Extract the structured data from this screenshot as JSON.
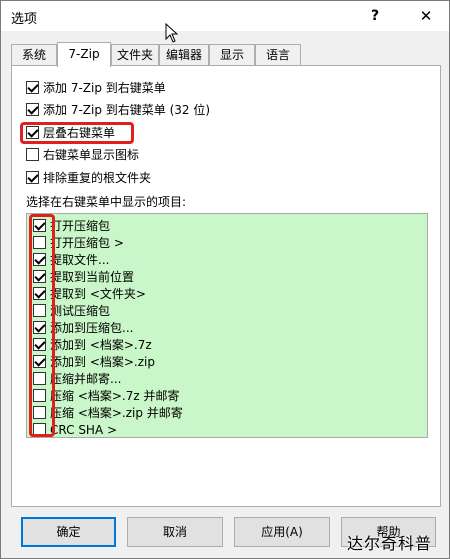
{
  "window": {
    "title": "选项",
    "help_label": "?",
    "close_label": "✕"
  },
  "tabs": [
    {
      "label": "系统",
      "active": false
    },
    {
      "label": "7-Zip",
      "active": true
    },
    {
      "label": "文件夹",
      "active": false
    },
    {
      "label": "编辑器",
      "active": false
    },
    {
      "label": "显示",
      "active": false
    },
    {
      "label": "语言",
      "active": false
    }
  ],
  "options": [
    {
      "label": "添加 7-Zip 到右键菜单",
      "checked": true
    },
    {
      "label": "添加 7-Zip 到右键菜单 (32 位)",
      "checked": true
    },
    {
      "label": "层叠右键菜单",
      "checked": true
    },
    {
      "label": "右键菜单显示图标",
      "checked": false
    },
    {
      "label": "排除重复的根文件夹",
      "checked": true
    }
  ],
  "context_menu_section": {
    "label": "选择在右键菜单中显示的项目:",
    "items": [
      {
        "label": "打开压缩包",
        "checked": true
      },
      {
        "label": "打开压缩包 >",
        "checked": false
      },
      {
        "label": "提取文件...",
        "checked": true
      },
      {
        "label": "提取到当前位置",
        "checked": true
      },
      {
        "label": "提取到 <文件夹>",
        "checked": true
      },
      {
        "label": "测试压缩包",
        "checked": false
      },
      {
        "label": "添加到压缩包...",
        "checked": true
      },
      {
        "label": "添加到 <档案>.7z",
        "checked": true
      },
      {
        "label": "添加到 <档案>.zip",
        "checked": true
      },
      {
        "label": "压缩并邮寄...",
        "checked": false
      },
      {
        "label": "压缩 <档案>.7z 并邮寄",
        "checked": false
      },
      {
        "label": "压缩 <档案>.zip 并邮寄",
        "checked": false
      },
      {
        "label": "CRC SHA >",
        "checked": false
      }
    ]
  },
  "buttons": {
    "ok": "确定",
    "cancel": "取消",
    "apply": "应用(A)",
    "help": "帮助"
  },
  "watermark": "达尔奇科普",
  "colors": {
    "highlight": "#e0201c",
    "list_background": "#c9f7c9",
    "default_button_border": "#0078d7"
  }
}
